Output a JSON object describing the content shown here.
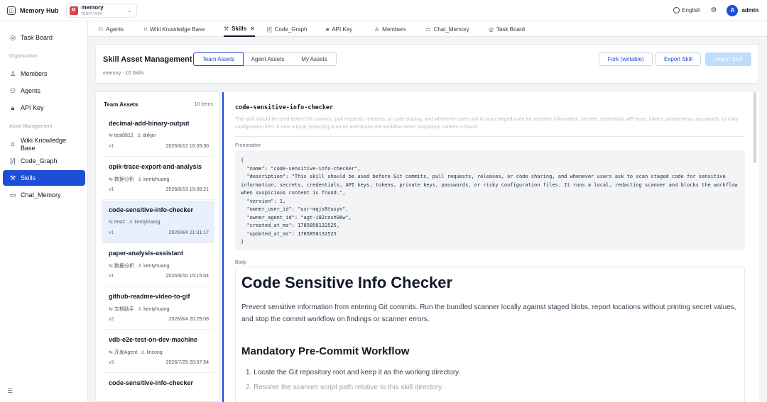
{
  "app": {
    "title": "Memory Hub",
    "space_initial": "M",
    "space_name": "memory",
    "space_sub": "team-wyc"
  },
  "topbar": {
    "language": "English",
    "user_initial": "A",
    "user_name": "admin"
  },
  "sidebar": {
    "task_board": "Task Board",
    "group_org": "Organization",
    "members": "Members",
    "agents": "Agents",
    "api_key": "API Key",
    "group_asset": "Asset Management",
    "wiki": "Wiki Knowledge Base",
    "code_graph": "Code_Graph",
    "skills": "Skills",
    "chat_memory": "Chat_Memory"
  },
  "tabs": [
    "Agents",
    "Wiki Knowledge Base",
    "Skills",
    "Code_Graph",
    "API Key",
    "Members",
    "Chat_Memory",
    "Task Board"
  ],
  "header": {
    "title": "Skill Asset Management",
    "seg_team": "Team Assets",
    "seg_agent": "Agent Assets",
    "seg_my": "My Assets",
    "subtitle": "memory · 10 Skills",
    "fork": "Fork (writable)",
    "export": "Export Skill",
    "import": "Import Skill"
  },
  "list": {
    "title": "Team Assets",
    "count": "10 items",
    "items": [
      {
        "name": "decimal-add-binary-output",
        "group": "test0812",
        "user": "dirkjin",
        "version": "v1",
        "time": "2026/8/12 16:09:30"
      },
      {
        "name": "opik-trace-export-and-analysis",
        "group": "数据分析",
        "user": "kentyhuang",
        "version": "v1",
        "time": "2026/8/13 15:06:21"
      },
      {
        "name": "code-sensitive-info-checker",
        "group": "test2",
        "user": "kentyhuang",
        "version": "v1",
        "time": "2026/8/4 21:31:17"
      },
      {
        "name": "paper-analysis-assistant",
        "group": "数据分析",
        "user": "kentyhuang",
        "version": "v1",
        "time": "2026/8/10 15:15:04"
      },
      {
        "name": "github-readme-video-to-gif",
        "group": "文档助手",
        "user": "kentyhuang",
        "version": "v2",
        "time": "2026/8/4 20:29:08"
      },
      {
        "name": "vdb-e2e-test-on-dev-machine",
        "group": "开发Agent",
        "user": "lincong",
        "version": "v3",
        "time": "2026/7/29 20:57:54"
      },
      {
        "name": "code-sensitive-info-checker",
        "group": "",
        "user": "",
        "version": "",
        "time": ""
      }
    ]
  },
  "detail": {
    "name": "code-sensitive-info-checker",
    "description": "This skill should be used before Git commits, pull requests, releases, or code sharing, and whenever users ask to scan staged code for sensitive information, secrets, credentials, API keys, tokens, private keys, passwords, or risky configuration files. It runs a local, redacting scanner and blocks the workflow when suspicious content is found.",
    "frontmatter_label": "Frontmatter",
    "frontmatter": "{\n  \"name\": \"code-sensitive-info-checker\",\n  \"description\": \"This skill should be used before Git commits, pull requests, releases, or code sharing, and whenever users ask to scan staged code for sensitive information, secrets, credentials, API keys, tokens, private keys, passwords, or risky configuration files. It runs a local, redacting scanner and blocks the workflow when suspicious content is found.\",\n  \"version\": 1,\n  \"owner_user_id\": \"usr-mqjs8tusyn\",\n  \"owner_agent_id\": \"agt-i82cosh96w\",\n  \"created_at_ms\": 1785850132525,\n  \"updated_at_ms\": 1785850132525\n}",
    "body_label": "Body",
    "h1": "Code Sensitive Info Checker",
    "p1": "Prevent sensitive information from entering Git commits. Run the bundled scanner locally against staged blobs, report locations without printing secret values, and stop the commit workflow on findings or scanner errors.",
    "h2": "Mandatory Pre-Commit Workflow",
    "li1": "1.  Locate the Git repository root and keep it as the working directory.",
    "li2": "2.  Resolve the scanner script path relative to this skill directory."
  }
}
